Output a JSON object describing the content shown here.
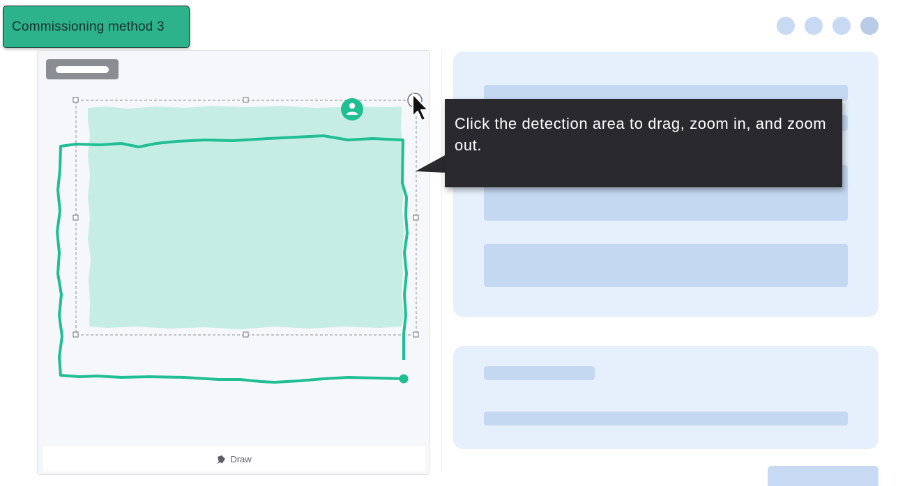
{
  "badge": {
    "label": "Commissioning method 3",
    "color": "#2db38c"
  },
  "window_controls": {
    "dots": [
      "dot-1",
      "dot-2",
      "dot-3",
      "dot-4"
    ]
  },
  "left_panel": {
    "image_label": "",
    "detection_area_fill": "#c6ede3",
    "detection_line_color": "#1fbe93",
    "user_marker_icon": "user-icon",
    "draw_button": {
      "icon": "draw-icon",
      "label": "Draw"
    }
  },
  "tooltip": {
    "text": "Click the detection area to drag, zoom in, and zoom out."
  },
  "cursor": {
    "icon": "cursor-arrow-icon"
  }
}
